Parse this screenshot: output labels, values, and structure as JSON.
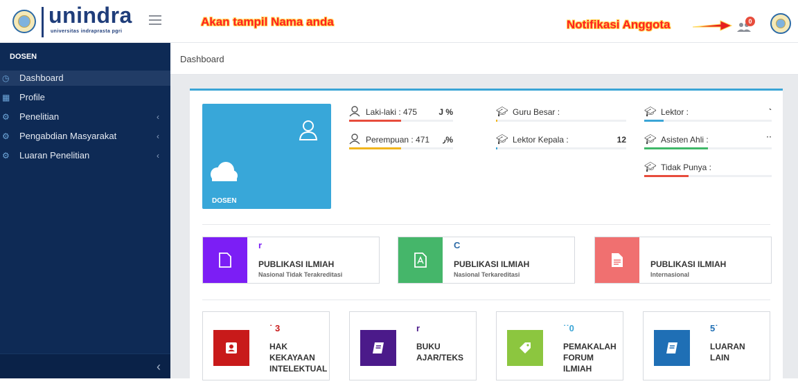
{
  "header": {
    "logo_text": "unindra",
    "logo_subtitle": "universitas indraprasta pgri",
    "annotation_name": "Akan tampil Nama anda",
    "annotation_notif": "Notifikasi Anggota",
    "notif_count": "0"
  },
  "sidebar": {
    "role": "DOSEN",
    "items": [
      {
        "label": "Dashboard",
        "icon": "dashboard-icon",
        "active": true
      },
      {
        "label": "Profile",
        "icon": "profile-icon"
      },
      {
        "label": "Penelitian",
        "icon": "research-icon",
        "chevron": "‹"
      },
      {
        "label": "Pengabdian Masyarakat",
        "icon": "community-icon",
        "chevron": "‹"
      },
      {
        "label": "Luaran Penelitian",
        "icon": "output-icon",
        "chevron": "‹"
      }
    ],
    "collapse_glyph": "‹"
  },
  "breadcrumb": "Dashboard",
  "dosen_tile": {
    "label": "DOSEN",
    "color": "#38a7d9"
  },
  "stats": {
    "male": {
      "label": "Laki-laki : 475",
      "value": "J %",
      "bar_color": "#e74c3c",
      "fill_pct": 50
    },
    "female": {
      "label": "Perempuan : 471",
      "value": "٫%",
      "bar_color": "#f1b51c",
      "fill_pct": 50
    },
    "guru_besar": {
      "label": "Guru Besar :",
      "value": "",
      "bar_color": "#f1b51c",
      "fill_pct": 1
    },
    "lektor_kepala": {
      "label": "Lektor Kepala :",
      "value": "12",
      "bar_color": "#3ba5d6",
      "fill_pct": 1
    },
    "lektor": {
      "label": "Lektor :",
      "value": "`",
      "bar_color": "#3ba5d6",
      "fill_pct": 15
    },
    "asisten_ahli": {
      "label": "Asisten Ahli :",
      "value": "˙˙",
      "bar_color": "#3fb868",
      "fill_pct": 50
    },
    "tidak_punya": {
      "label": "Tidak Punya :",
      "value": "",
      "bar_color": "#e74c3c",
      "fill_pct": 35
    }
  },
  "publications": [
    {
      "num": "r",
      "title": "PUBLIKASI ILMIAH",
      "subtitle": "Nasional Tidak Terakreditasi",
      "color": "#7c1ef5",
      "num_color": "#7c1ef5"
    },
    {
      "num": "C",
      "title": "PUBLIKASI ILMIAH",
      "subtitle": "Nasional Terkareditasi",
      "color": "#45b66a",
      "num_color": "#2c6aa6"
    },
    {
      "num": "",
      "title": "PUBLIKASI ILMIAH",
      "subtitle": "Internasional",
      "color": "#f07070",
      "num_color": "#333"
    }
  ],
  "cards": [
    {
      "num": "˙ 3",
      "title": "HAK KEKAYAAN INTELEKTUAL",
      "color": "#c81a1a",
      "num_color": "#c81a1a"
    },
    {
      "num": "r",
      "title": "BUKU AJAR/TEKS",
      "color": "#4b1a8a",
      "num_color": "#4b1a8a"
    },
    {
      "num": "˙˙0",
      "title": "PEMAKALAH FORUM ILMIAH",
      "color": "#8cc63f",
      "num_color": "#3ba5d6"
    },
    {
      "num": "5˙",
      "title": "LUARAN LAIN",
      "color": "#1f6fb5",
      "num_color": "#1f6fb5"
    }
  ]
}
